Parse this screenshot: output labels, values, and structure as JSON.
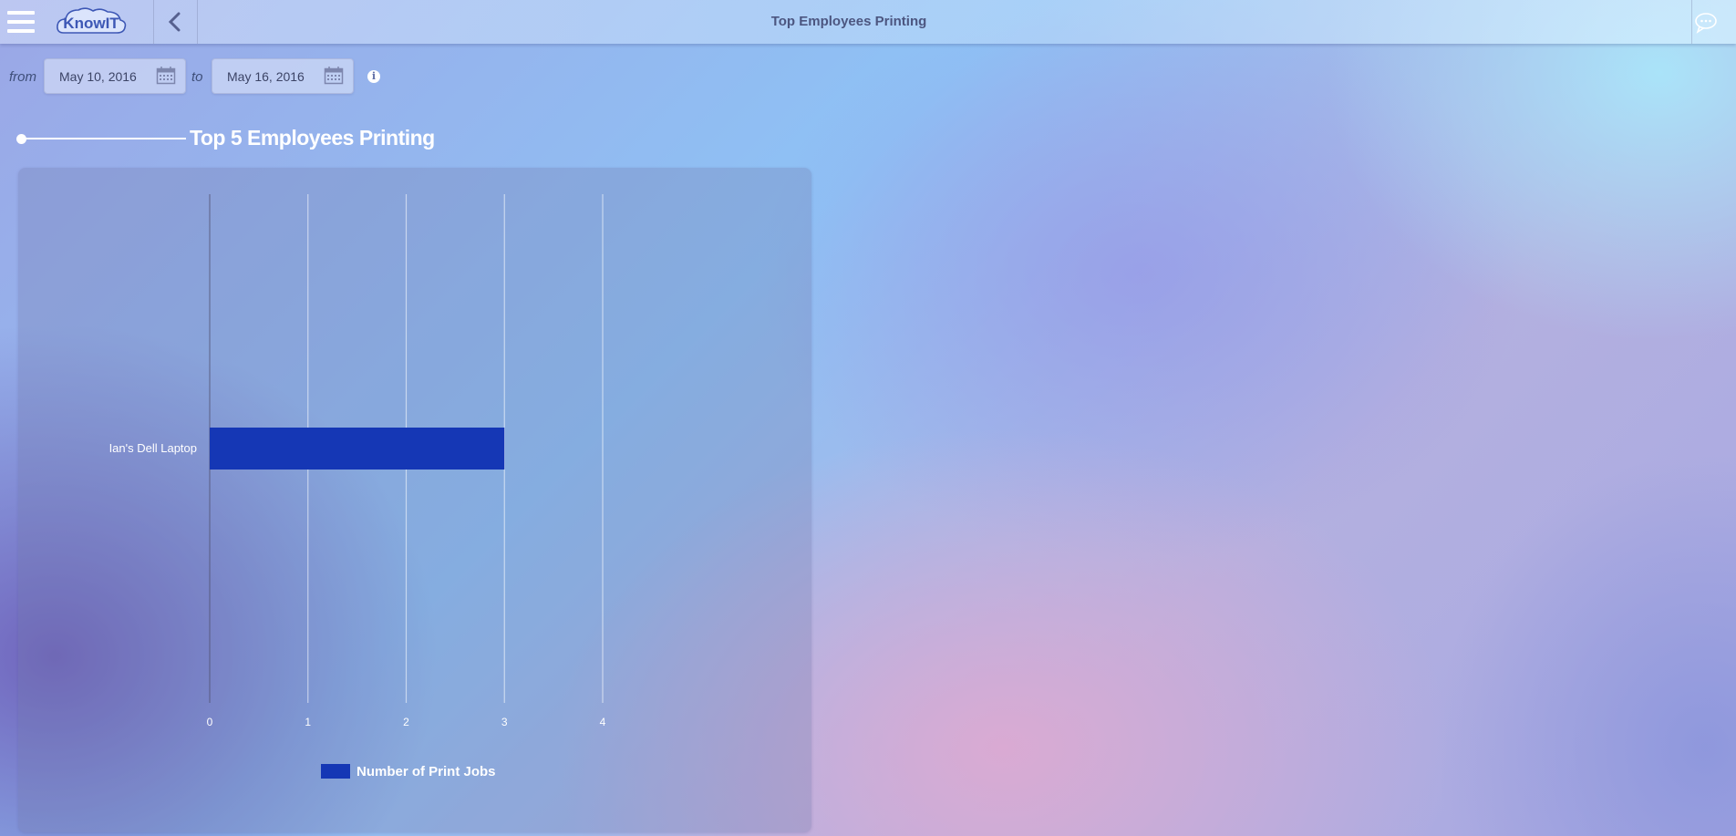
{
  "app": {
    "title": "Top Employees Printing",
    "logo_text": "KnowIT"
  },
  "filters": {
    "from_label": "from",
    "to_label": "to",
    "from_date": "May 10, 2016",
    "to_date": "May 16, 2016"
  },
  "section": {
    "title": "Top 5 Employees Printing"
  },
  "chart_data": {
    "type": "bar",
    "orientation": "horizontal",
    "categories": [
      "Ian's Dell Laptop"
    ],
    "series": [
      {
        "name": "Number of Print Jobs",
        "values": [
          3
        ],
        "color": "#1537b5"
      }
    ],
    "xlim": [
      0,
      4
    ],
    "xticks": [
      "0",
      "1",
      "2",
      "3",
      "4"
    ],
    "grid": true,
    "legend_position": "bottom"
  },
  "icons": {
    "menu": "hamburger-menu-icon",
    "back": "chevron-left-icon",
    "chat": "chat-bubble-icon",
    "calendar": "calendar-icon",
    "info": "info-icon"
  }
}
